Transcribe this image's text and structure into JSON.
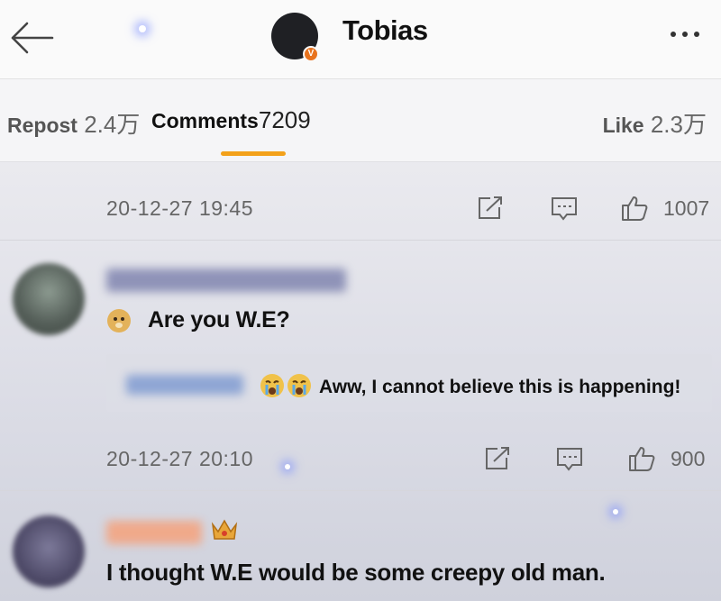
{
  "header": {
    "title": "Tobias",
    "verified_badge": "V",
    "icons": [
      "back-arrow-icon",
      "more-icon"
    ]
  },
  "tabs": {
    "repost_label": "Repost",
    "repost_count": "2.4万",
    "comments_label": "Comments",
    "comments_count": "7209",
    "like_label": "Like",
    "like_count": "2.3万",
    "accent_color": "#f3a11a"
  },
  "comments": [
    {
      "timestamp": "20-12-27 19:45",
      "likes": "1007"
    },
    {
      "text": "Are you W.E?",
      "reply_text": "Aww, I cannot believe this is happening!",
      "timestamp": "20-12-27 20:10",
      "likes": "900"
    },
    {
      "text": "I thought W.E would be some creepy old man."
    }
  ],
  "action_icons": [
    "share-icon",
    "comment-icon",
    "thumbs-up-icon"
  ]
}
